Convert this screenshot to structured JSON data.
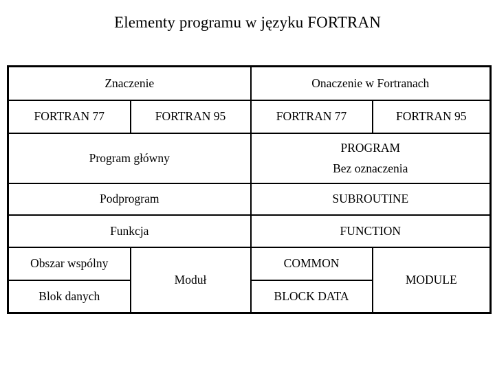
{
  "slide": {
    "title": "Elementy programu w języku FORTRAN",
    "background_color": "#ffffff",
    "text_color": "#000000",
    "border_color": "#000000"
  },
  "table": {
    "group_headers": {
      "left": "Znaczenie",
      "right": "Onaczenie w Fortranach"
    },
    "sub_headers": {
      "left_77": "FORTRAN 77",
      "left_95": "FORTRAN 95",
      "right_77": "FORTRAN 77",
      "right_95": "FORTRAN 95"
    },
    "rows": [
      {
        "meaning": "Program główny",
        "fortran_line1": "PROGRAM",
        "fortran_line2": "Bez oznaczenia"
      },
      {
        "meaning": "Podprogram",
        "fortran": "SUBROUTINE"
      },
      {
        "meaning": "Funkcja",
        "fortran": "FUNCTION"
      }
    ],
    "split_row": {
      "meaning_77_top": "Obszar wspólny",
      "meaning_77_bottom": "Blok danych",
      "meaning_95": "Moduł",
      "fortran_77_top": "COMMON",
      "fortran_77_bottom": "BLOCK DATA",
      "fortran_95": "MODULE"
    }
  }
}
